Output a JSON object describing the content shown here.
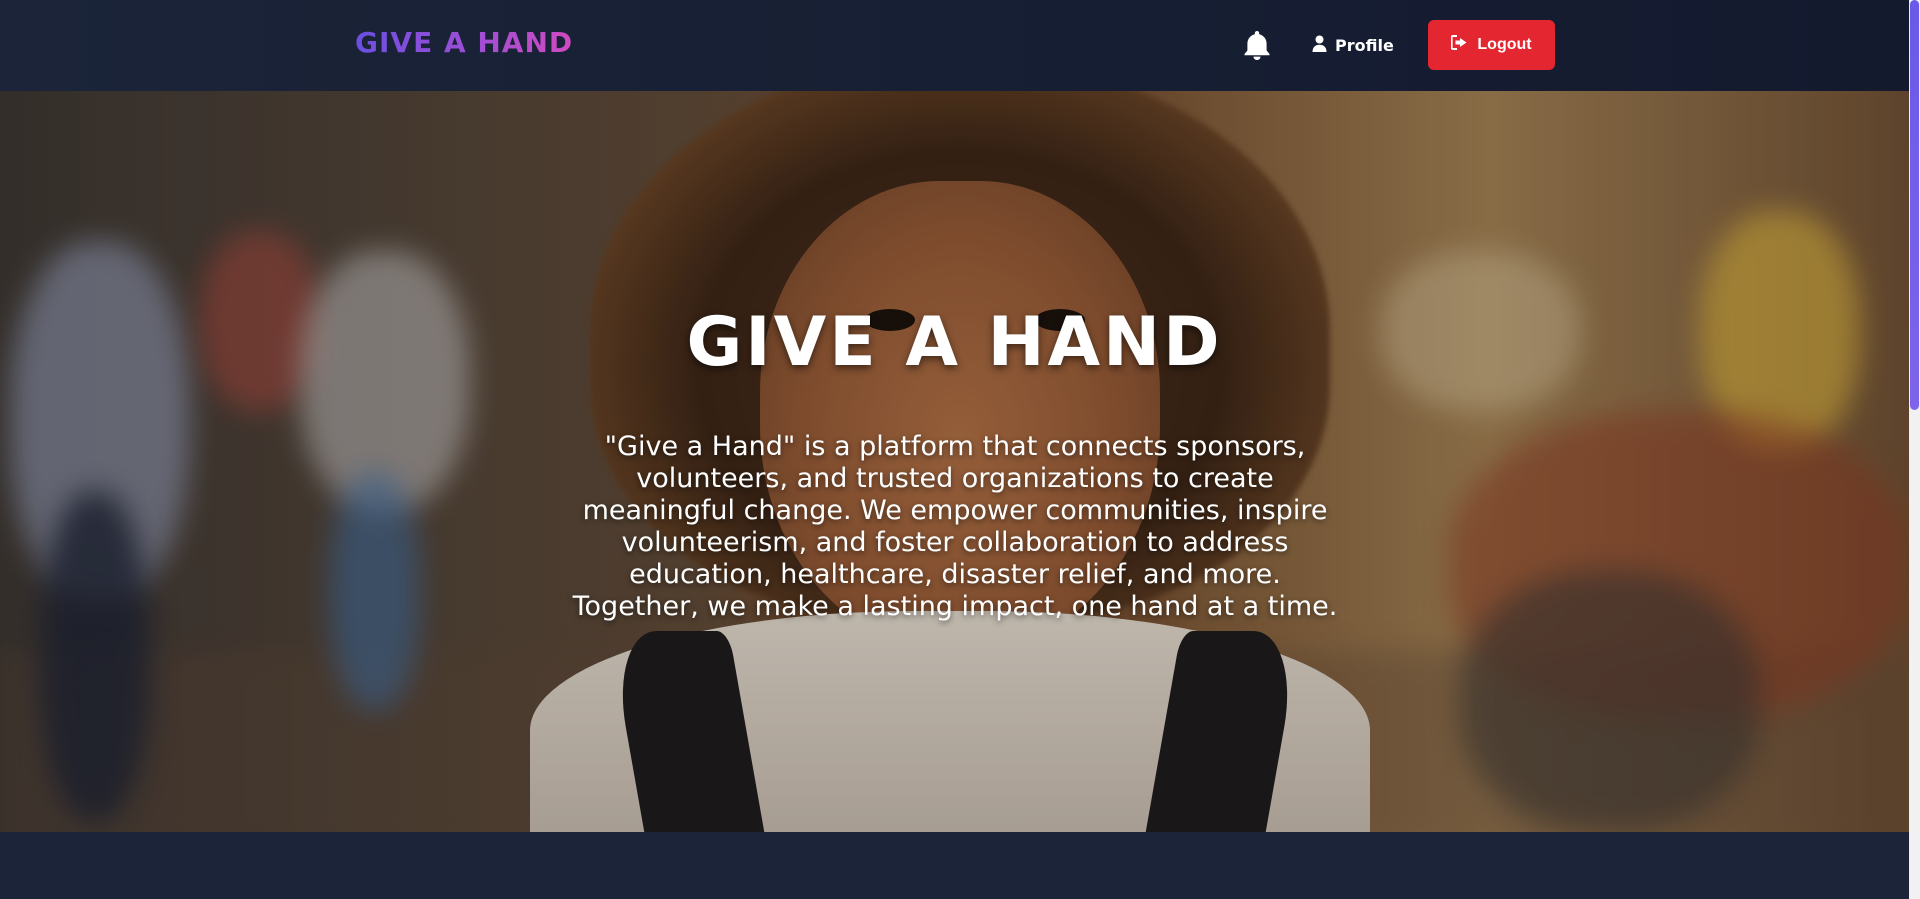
{
  "navbar": {
    "brand": "GIVE A HAND",
    "bell_icon": "bell-icon",
    "profile_label": "Profile",
    "profile_icon": "user-icon",
    "logout_label": "Logout",
    "logout_icon": "sign-out-icon"
  },
  "hero": {
    "title": "GIVE A HAND",
    "description": "\"Give a Hand\" is a platform that connects sponsors, volunteers, and trusted organizations to create meaningful change. We empower communities, inspire volunteerism, and foster collaboration to address education, healthcare, disaster relief, and more. Together, we make a lasting impact, one hand at a time."
  },
  "colors": {
    "brand_gradient_start": "#6a4fe0",
    "brand_gradient_end": "#d04ac0",
    "logout_button": "#e3262f",
    "navbar_background": "#1b2438",
    "scrollbar_thumb": "#6a5ae8"
  }
}
